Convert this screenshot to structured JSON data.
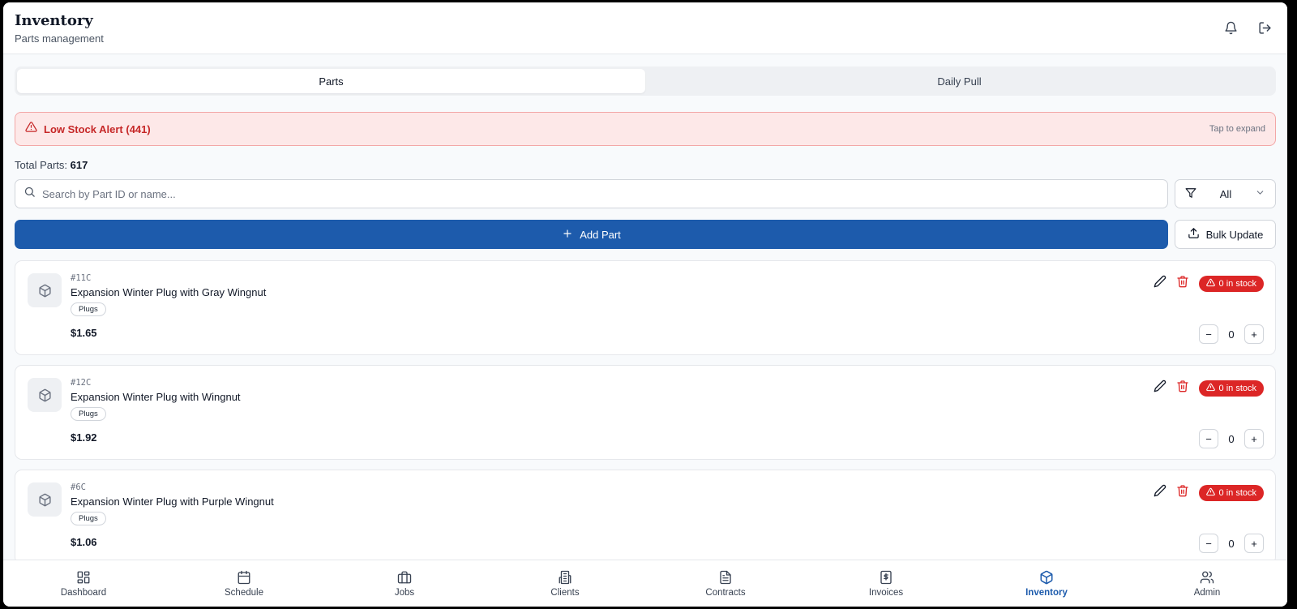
{
  "header": {
    "title": "Inventory",
    "subtitle": "Parts management"
  },
  "tabs": [
    {
      "label": "Parts",
      "active": true
    },
    {
      "label": "Daily Pull",
      "active": false
    }
  ],
  "alert": {
    "title": "Low Stock Alert (441)",
    "hint": "Tap to expand"
  },
  "totals": {
    "label": "Total Parts:",
    "value": "617"
  },
  "search": {
    "placeholder": "Search by Part ID or name...",
    "value": ""
  },
  "filter": {
    "selected": "All"
  },
  "actions": {
    "add_label": "Add Part",
    "bulk_label": "Bulk Update"
  },
  "parts": [
    {
      "id": "#11C",
      "name": "Expansion Winter Plug with Gray Wingnut",
      "category": "Plugs",
      "price": "$1.65",
      "stock_label": "0 in stock",
      "quantity": "0"
    },
    {
      "id": "#12C",
      "name": "Expansion Winter Plug with Wingnut",
      "category": "Plugs",
      "price": "$1.92",
      "stock_label": "0 in stock",
      "quantity": "0"
    },
    {
      "id": "#6C",
      "name": "Expansion Winter Plug with Purple Wingnut",
      "category": "Plugs",
      "price": "$1.06",
      "stock_label": "0 in stock",
      "quantity": "0"
    }
  ],
  "nav": [
    {
      "label": "Dashboard",
      "icon": "grid-icon"
    },
    {
      "label": "Schedule",
      "icon": "calendar-icon"
    },
    {
      "label": "Jobs",
      "icon": "briefcase-icon"
    },
    {
      "label": "Clients",
      "icon": "building-icon"
    },
    {
      "label": "Contracts",
      "icon": "file-icon"
    },
    {
      "label": "Invoices",
      "icon": "dollar-icon"
    },
    {
      "label": "Inventory",
      "icon": "package-icon",
      "active": true
    },
    {
      "label": "Admin",
      "icon": "users-icon"
    }
  ],
  "colors": {
    "primary": "#1d5bac",
    "danger": "#dc2626",
    "alert_bg": "#fde8e8"
  }
}
